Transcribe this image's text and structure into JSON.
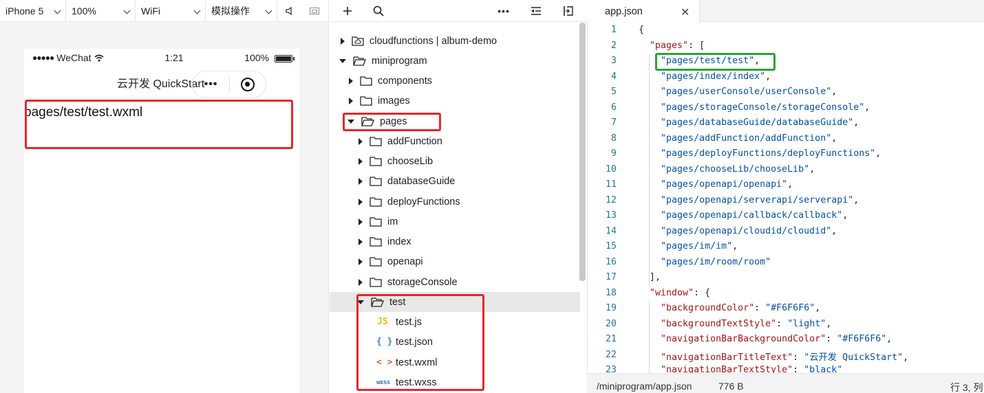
{
  "simulator": {
    "toolbar": {
      "device": "iPhone 5",
      "zoom": "100%",
      "network": "WiFi",
      "operations": "模拟操作"
    },
    "status_bar": {
      "carrier": "WeChat",
      "time": "1:21",
      "battery": "100%"
    },
    "nav_title": "云开发 QuickStart",
    "page_text": "pages/test/test.wxml"
  },
  "explorer": {
    "toolbar_icons": [
      "plus-icon",
      "search-icon",
      "more-icon",
      "outdent-icon",
      "split-icon"
    ],
    "tree": [
      {
        "label": "cloudfunctions | album-demo",
        "depth": 0,
        "state": "collapsed",
        "icon": "cloud-folder"
      },
      {
        "label": "miniprogram",
        "depth": 0,
        "state": "expanded",
        "icon": "folder-open"
      },
      {
        "label": "components",
        "depth": 1,
        "state": "collapsed",
        "icon": "folder"
      },
      {
        "label": "images",
        "depth": 1,
        "state": "collapsed",
        "icon": "folder"
      },
      {
        "label": "pages",
        "depth": 1,
        "state": "expanded",
        "icon": "folder-open"
      },
      {
        "label": "addFunction",
        "depth": 2,
        "state": "collapsed",
        "icon": "folder"
      },
      {
        "label": "chooseLib",
        "depth": 2,
        "state": "collapsed",
        "icon": "folder"
      },
      {
        "label": "databaseGuide",
        "depth": 2,
        "state": "collapsed",
        "icon": "folder"
      },
      {
        "label": "deployFunctions",
        "depth": 2,
        "state": "collapsed",
        "icon": "folder"
      },
      {
        "label": "im",
        "depth": 2,
        "state": "collapsed",
        "icon": "folder"
      },
      {
        "label": "index",
        "depth": 2,
        "state": "collapsed",
        "icon": "folder"
      },
      {
        "label": "openapi",
        "depth": 2,
        "state": "collapsed",
        "icon": "folder"
      },
      {
        "label": "storageConsole",
        "depth": 2,
        "state": "collapsed",
        "icon": "folder"
      },
      {
        "label": "test",
        "depth": 2,
        "state": "expanded",
        "icon": "folder-open",
        "selected": true
      },
      {
        "label": "test.js",
        "depth": 3,
        "state": "file",
        "icon": "JS"
      },
      {
        "label": "test.json",
        "depth": 3,
        "state": "file",
        "icon": "{ }"
      },
      {
        "label": "test.wxml",
        "depth": 3,
        "state": "file",
        "icon": "< >"
      },
      {
        "label": "test.wxss",
        "depth": 3,
        "state": "file",
        "icon": "wxss"
      }
    ]
  },
  "editor": {
    "tab": "app.json",
    "lines": [
      "{",
      "  \"pages\": [",
      "    \"pages/test/test\",",
      "    \"pages/index/index\",",
      "    \"pages/userConsole/userConsole\",",
      "    \"pages/storageConsole/storageConsole\",",
      "    \"pages/databaseGuide/databaseGuide\",",
      "    \"pages/addFunction/addFunction\",",
      "    \"pages/deployFunctions/deployFunctions\",",
      "    \"pages/chooseLib/chooseLib\",",
      "    \"pages/openapi/openapi\",",
      "    \"pages/openapi/serverapi/serverapi\",",
      "    \"pages/openapi/callback/callback\",",
      "    \"pages/openapi/cloudid/cloudid\",",
      "    \"pages/im/im\",",
      "    \"pages/im/room/room\"",
      "  ],",
      "  \"window\": {",
      "    \"backgroundColor\": \"#F6F6F6\",",
      "    \"backgroundTextStyle\": \"light\",",
      "    \"navigationBarBackgroundColor\": \"#F6F6F6\",",
      "    \"navigationBarTitleText\": \"云开发 QuickStart\",",
      "    \"navigationBarTextStyle\": \"black\""
    ],
    "status": {
      "path": "/miniprogram/app.json",
      "size": "776 B",
      "position": "行 3, 列"
    }
  },
  "colors": {
    "highlight_red": "#e8262a",
    "highlight_green": "#27a634",
    "json_key": "#a31515",
    "json_string": "#0451a5",
    "line_number": "#237893"
  }
}
